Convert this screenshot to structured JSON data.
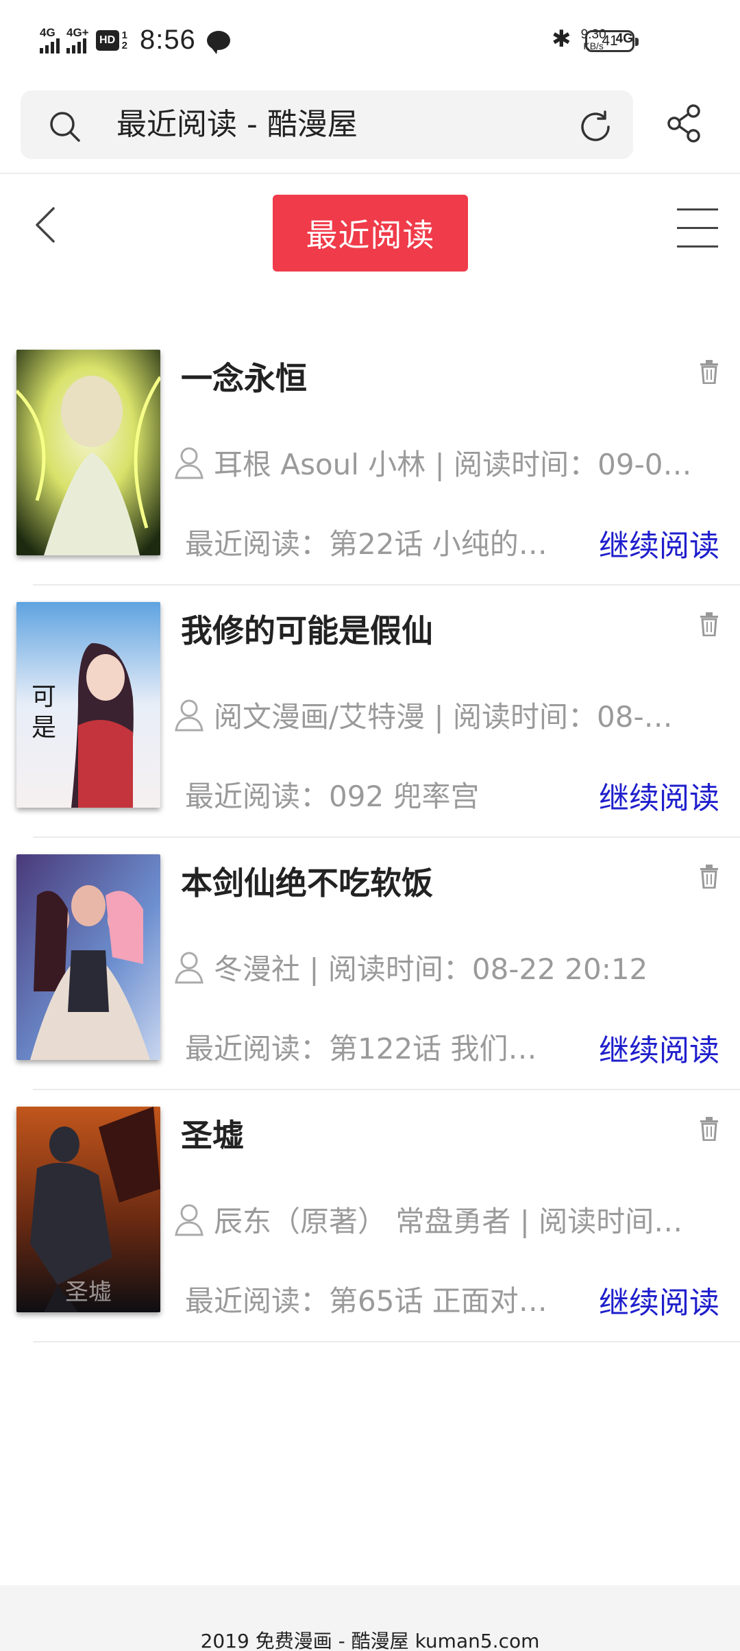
{
  "status_bar": {
    "network_1": "4G",
    "network_2": "4G+",
    "hd_label": "HD",
    "hd_sub_1": "1",
    "hd_sub_2": "2",
    "time": "8:56",
    "speed_value": "9.30",
    "speed_unit": "KB/s",
    "network_right": "4G",
    "battery": "41"
  },
  "browser": {
    "url_text": "最近阅读 - 酷漫屋"
  },
  "header": {
    "title": "最近阅读"
  },
  "items": [
    {
      "title": "一念永恒",
      "author_line": "耳根 Asoul 小林 | 阅读时间：09-0…",
      "recent": "最近阅读：第22话 小纯的…",
      "action": "继续阅读",
      "cover_colors": [
        "#1d2a10",
        "#d8e26a",
        "#f4f4d0"
      ]
    },
    {
      "title": "我修的可能是假仙",
      "author_line": "阅文漫画/艾特漫 | 阅读时间：08-…",
      "recent": "最近阅读：092 兜率宫",
      "action": "继续阅读",
      "cover_colors": [
        "#5fa3e0",
        "#c4343c",
        "#3a2230"
      ]
    },
    {
      "title": "本剑仙绝不吃软饭",
      "author_line": "冬漫社 | 阅读时间：08-22 20:12",
      "recent": "最近阅读：第122话 我们…",
      "action": "继续阅读",
      "cover_colors": [
        "#4a3a7a",
        "#e9b7a8",
        "#6d8fcf"
      ]
    },
    {
      "title": "圣墟",
      "author_line": "辰东（原著） 常盘勇者 | 阅读时间…",
      "recent": "最近阅读：第65话 正面对…",
      "action": "继续阅读",
      "cover_caption": "圣墟",
      "cover_colors": [
        "#c2561c",
        "#2b2b35",
        "#0e0e12"
      ]
    }
  ],
  "footer": {
    "text": "2019 免费漫画 - 酷漫屋 kuman5.com"
  },
  "colors": {
    "accent": "#f03b4a",
    "link": "#1e1ecc",
    "muted": "#9a9a9a"
  }
}
